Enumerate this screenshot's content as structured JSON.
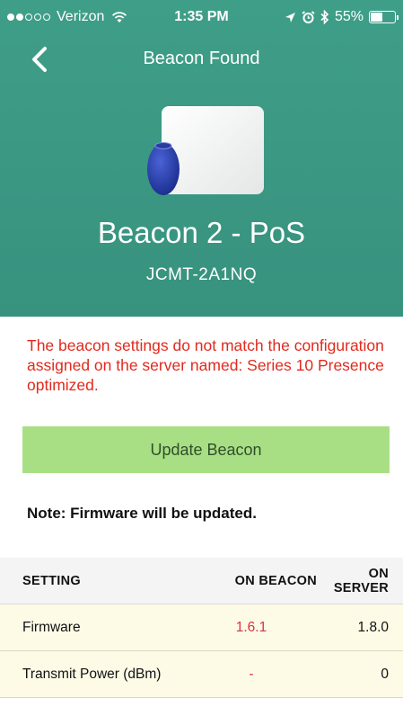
{
  "status_bar": {
    "carrier": "Verizon",
    "time": "1:35 PM",
    "battery": "55%",
    "battery_level": 0.55
  },
  "nav": {
    "title": "Beacon Found",
    "back_icon": "chevron-left-icon"
  },
  "beacon": {
    "name": "Beacon 2 - PoS",
    "id": "JCMT-2A1NQ"
  },
  "warning_text": "The beacon settings do not match the configuration assigned on the server named: Series 10 Presence optimized.",
  "update_button_label": "Update Beacon",
  "note": "Note: Firmware will be updated.",
  "table": {
    "headers": {
      "setting": "SETTING",
      "on_beacon": "ON BEACON",
      "on_server": "ON SERVER"
    },
    "rows": [
      {
        "setting": "Firmware",
        "on_beacon": "1.6.1",
        "on_server": "1.8.0"
      },
      {
        "setting": "Transmit Power (dBm)",
        "on_beacon": "-",
        "on_server": "0"
      }
    ]
  },
  "colors": {
    "header_bg": "#3f9e88",
    "warning": "#e12a1e",
    "button_bg": "#a9df84",
    "row_bg": "#fdfbe6",
    "mismatch": "#d8323e"
  }
}
